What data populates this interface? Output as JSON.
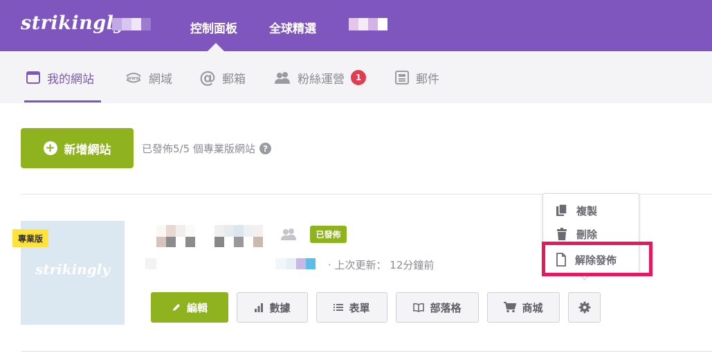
{
  "colors": {
    "brand": "#7e56bd",
    "green": "#8fb21f",
    "badge_red": "#e23c50",
    "highlight": "#e8185f",
    "pro_yellow": "#ffe23b"
  },
  "header": {
    "logo": "strikingly",
    "nav": [
      "控制面板",
      "全球精選"
    ]
  },
  "subnav": {
    "items": [
      {
        "label": "我的網站",
        "icon": "browser-icon"
      },
      {
        "label": "網域",
        "icon": "www-icon"
      },
      {
        "label": "郵箱",
        "icon": "at-icon"
      },
      {
        "label": "粉絲運營",
        "icon": "users-icon",
        "badge": "1"
      },
      {
        "label": "郵件",
        "icon": "newsletter-icon"
      }
    ]
  },
  "main": {
    "new_site_label": "新增網站",
    "published_info": "已發佈5/5 個專業版網站",
    "help_mark": "?"
  },
  "site": {
    "thumb_logo": "strikingly",
    "pro_tag": "專業版",
    "published_tag": "已發佈",
    "last_updated": "· 上次更新： 12分鐘前",
    "actions": [
      "編輯",
      "數據",
      "表單",
      "部落格",
      "商城"
    ]
  },
  "menu": {
    "items": [
      "複製",
      "刪除",
      "解除發佈"
    ]
  }
}
